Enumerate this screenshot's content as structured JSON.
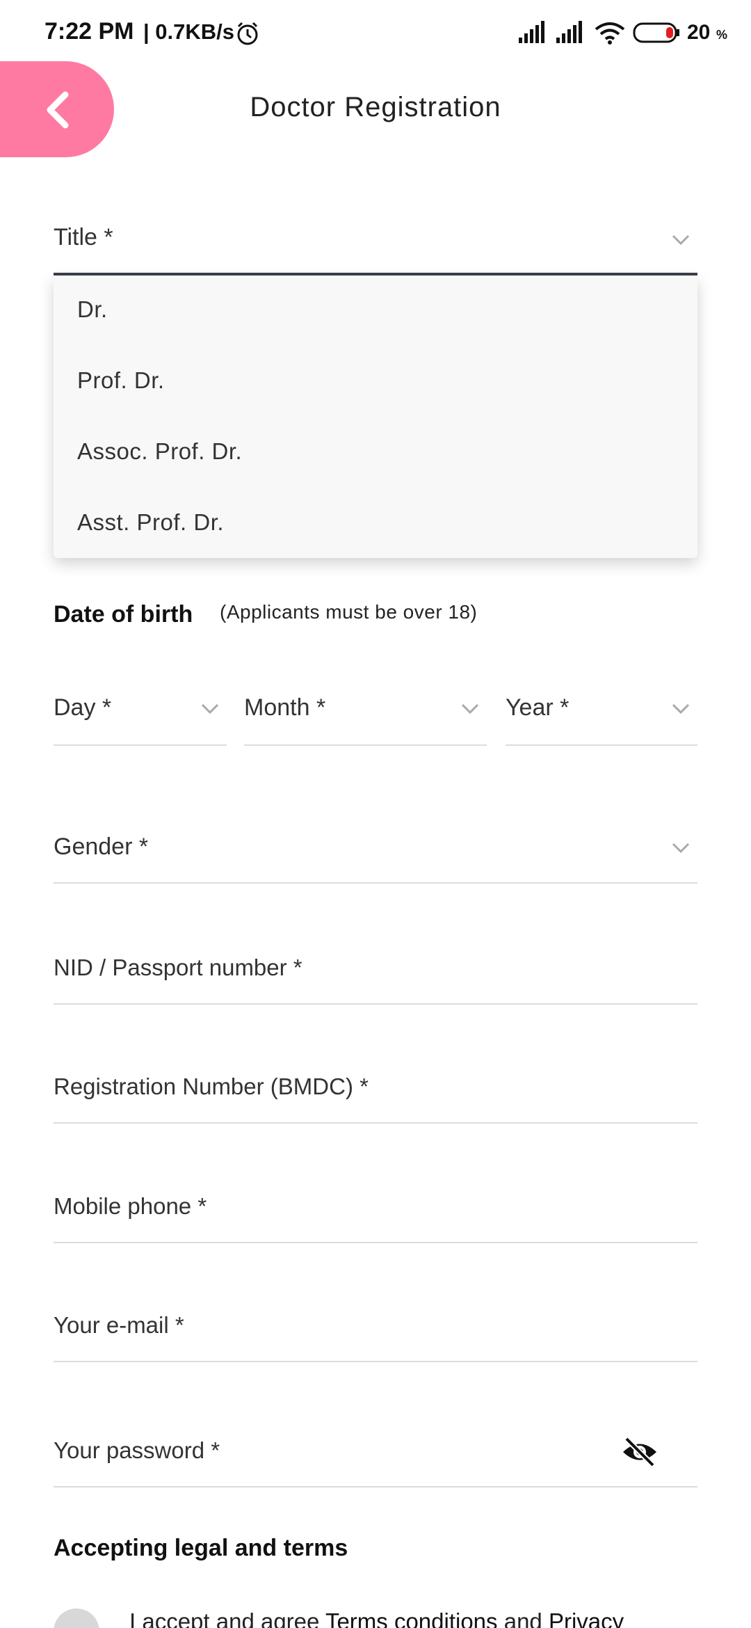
{
  "status_bar": {
    "time": "7:22 PM",
    "network_speed": "| 0.7KB/s",
    "battery": "20"
  },
  "header": {
    "title": "Doctor Registration"
  },
  "form": {
    "title_label": "Title *",
    "title_options": [
      "Dr.",
      "Prof. Dr.",
      "Assoc. Prof. Dr.",
      "Asst. Prof. Dr."
    ],
    "dob_heading": "Date of birth",
    "dob_note": "(Applicants must be over 18)",
    "day_label": "Day *",
    "month_label": "Month *",
    "year_label": "Year *",
    "gender_label": "Gender *",
    "nid_label": "NID / Passport number *",
    "registration_label": "Registration Number (BMDC) *",
    "mobile_label": "Mobile phone *",
    "email_label": "Your e-mail *",
    "password_label": "Your password *",
    "legal_heading": "Accepting legal and terms",
    "accept_prefix": "I accept and agree ",
    "terms_link": "Terms conditions",
    "accept_and": " and ",
    "privacy_link": "Privacy"
  },
  "colors": {
    "accent": "#ff7aa2",
    "focus_underline": "#3b3f47"
  }
}
